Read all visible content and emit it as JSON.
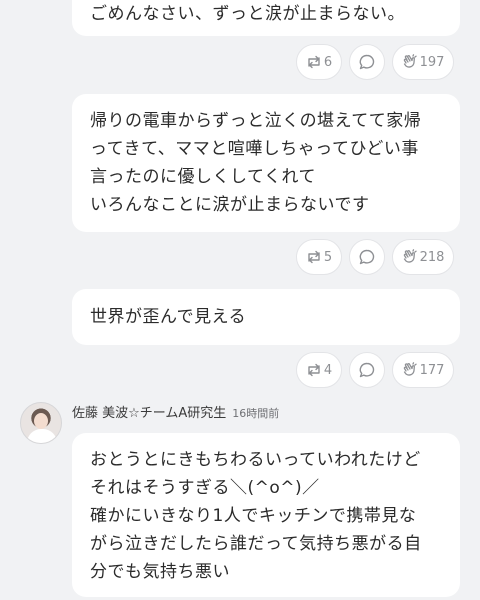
{
  "messages": [
    {
      "lines": [
        "ごめんなさい、ずっと涙が止まらない。"
      ],
      "retweets": "6",
      "likes": "197"
    },
    {
      "lines": [
        "帰りの電車からずっと泣くの堪えてて家帰",
        "ってきて、ママと喧嘩しちゃってひどい事",
        "言ったのに優しくしてくれて",
        "いろんなことに涙が止まらないです"
      ],
      "retweets": "5",
      "likes": "218"
    },
    {
      "lines": [
        "世界が歪んで見える"
      ],
      "retweets": "4",
      "likes": "177"
    },
    {
      "lines": [
        "おとうとにきもちわるいっていわれたけど",
        "それはそうすぎる＼(^o^)／",
        "確かにいきなり1人でキッチンで携帯見な",
        "がら泣きだしたら誰だって気持ち悪がる自",
        "分でも気持ち悪い"
      ]
    }
  ],
  "author": {
    "name": "佐藤 美波☆チームA研究生",
    "time": "16時間前"
  },
  "icons": {
    "retweet": "retweet-icon",
    "comment": "comment-icon",
    "like": "clap-icon",
    "avatar": "avatar"
  },
  "colors": {
    "background": "#f1f2f4",
    "bubble": "#ffffff",
    "icon": "#8e9094"
  }
}
